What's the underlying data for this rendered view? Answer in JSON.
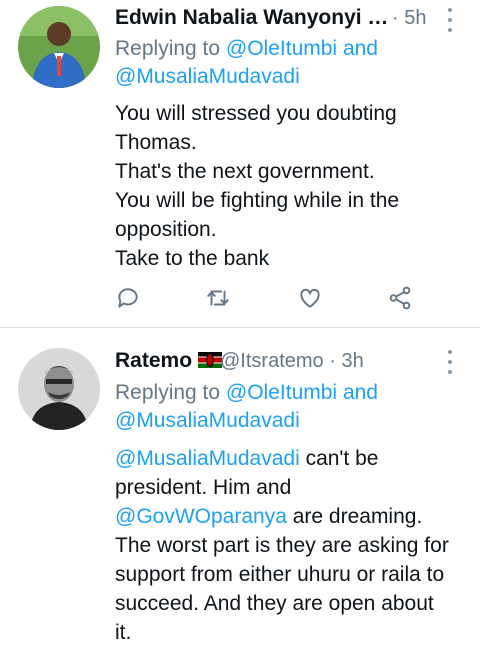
{
  "tweets": [
    {
      "author": "Edwin Nabalia Wanyonyi …",
      "time": "· 5h",
      "replying_prefix": "Replying to",
      "replying_to_1": "@OleItumbi",
      "replying_joiner": "and",
      "replying_to_2": "@MusaliaMudavadi",
      "lines": [
        "You will stressed you doubting",
        "Thomas.",
        "That's the next government.",
        "You will be fighting while in the",
        "opposition.",
        "Take to the bank"
      ]
    },
    {
      "author": "Ratemo",
      "flag": "kenya-flag",
      "handle": "@Itsratemo",
      "time": "· 3h",
      "replying_prefix": "Replying to",
      "replying_to_1": "@OleItumbi",
      "replying_joiner": "and",
      "replying_to_2": "@MusaliaMudavadi",
      "line1_mention": "@MusaliaMudavadi",
      "line1_rest": " can't be",
      "line2": "president. Him and",
      "line3_mention": "@GovWOparanya",
      "line3_rest": " are dreaming.",
      "line4": "The worst part is they are asking for",
      "line5": "support from either uhuru or raila to",
      "line6": "succeed. And they are open about",
      "line7": "it."
    }
  ],
  "icons": [
    "reply-icon",
    "retweet-icon",
    "like-icon",
    "share-icon",
    "more-icon"
  ],
  "colors": {
    "link": "#1da1f2",
    "muted": "#657786",
    "text": "#0f1419"
  }
}
